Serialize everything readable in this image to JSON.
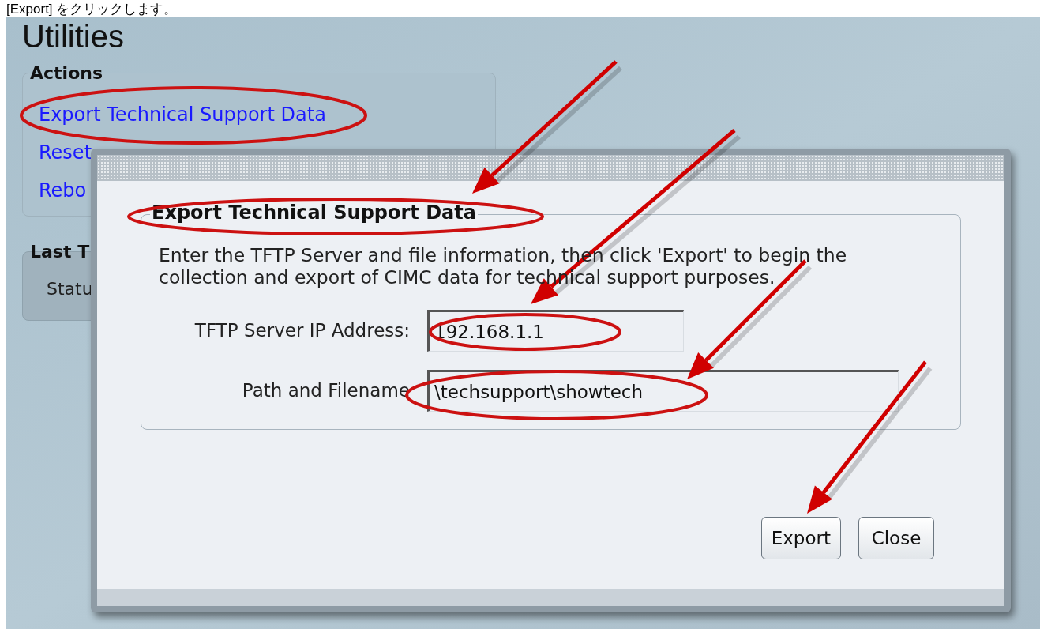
{
  "caption": "[Export] をクリックします。",
  "page": {
    "title": "Utilities",
    "actions": {
      "title": "Actions",
      "links": [
        "Export Technical Support Data",
        "Reset",
        "Rebo"
      ]
    },
    "last_panel": {
      "title": "Last T",
      "rows": [
        "Statu"
      ]
    }
  },
  "dialog": {
    "section_title": "Export Technical Support Data",
    "description": "Enter the TFTP Server and file information, then click 'Export' to begin the collection and export of CIMC data for technical support purposes.",
    "fields": [
      {
        "label": "TFTP Server IP Address:",
        "value": "192.168.1.1"
      },
      {
        "label": "Path and Filename",
        "value": "\\techsupport\\showtech"
      }
    ],
    "buttons": [
      "Export",
      "Close"
    ]
  }
}
